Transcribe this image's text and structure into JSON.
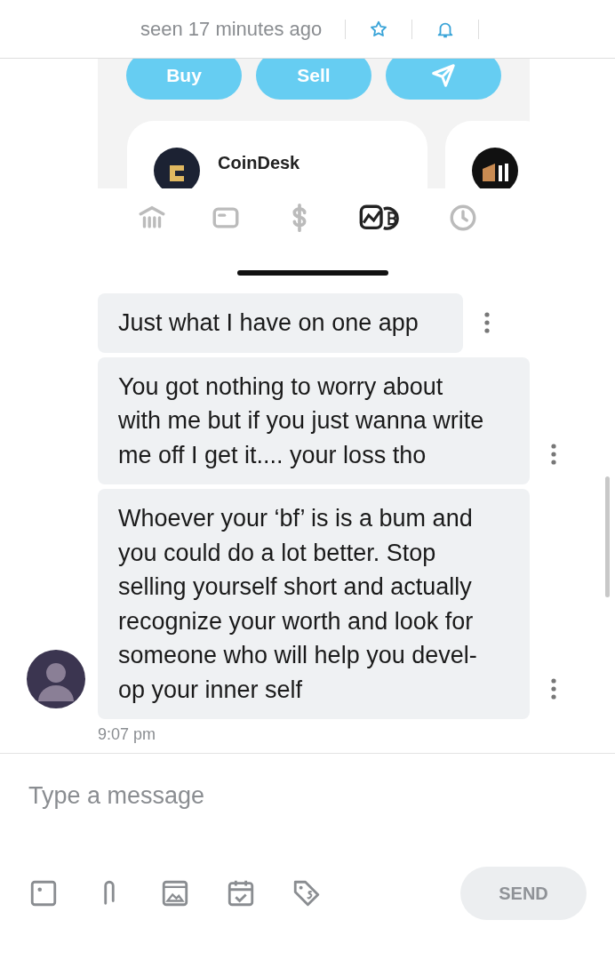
{
  "header": {
    "status": "seen 17 minutes ago",
    "actions": [
      {
        "kind": "star"
      },
      {
        "kind": "bell"
      }
    ]
  },
  "shared_screenshot": {
    "actions": [
      {
        "kind": "text",
        "label": "Buy"
      },
      {
        "kind": "text",
        "label": "Sell"
      },
      {
        "kind": "send"
      }
    ],
    "cards": [
      {
        "kind": "coindesk",
        "title": "CoinDesk"
      },
      {
        "kind": "bars"
      }
    ],
    "nav": [
      {
        "kind": "bank",
        "selected": false
      },
      {
        "kind": "card",
        "selected": false
      },
      {
        "kind": "dollar",
        "selected": false
      },
      {
        "kind": "invest",
        "selected": true
      },
      {
        "kind": "clock",
        "selected": false
      }
    ]
  },
  "messages": [
    {
      "text": "Just what I have on one app"
    },
    {
      "text": "You got nothing to worry about with me but if you just wanna write me off I get it.... your loss tho"
    },
    {
      "text": "Whoever your ‘bf’ is is a bum and you could do a lot better. Stop selling yourself short and actually recognize your worth and look for someone who will help you devel-op your inner self"
    }
  ],
  "time": "9:07 pm",
  "composer": {
    "placeholder": "Type a message",
    "tools": [
      {
        "kind": "image"
      },
      {
        "kind": "clip"
      },
      {
        "kind": "media"
      },
      {
        "kind": "calendar"
      },
      {
        "kind": "tag"
      }
    ],
    "send": {
      "label": "SEND",
      "disabled": true
    }
  }
}
